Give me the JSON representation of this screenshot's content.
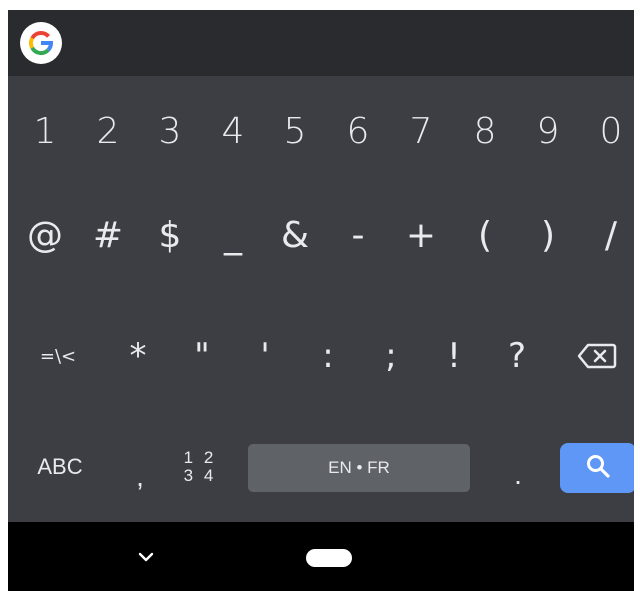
{
  "top_bar": {
    "logo_icon": "google-logo-icon",
    "logo_letter": "G"
  },
  "keyboard": {
    "number_row": [
      "1",
      "2",
      "3",
      "4",
      "5",
      "6",
      "7",
      "8",
      "9",
      "0"
    ],
    "symbol_row": [
      "@",
      "#",
      "$",
      "_",
      "&",
      "-",
      "+",
      "(",
      ")",
      "/"
    ],
    "third_row": {
      "more_symbols": "=\\<",
      "keys": [
        "*",
        "\"",
        "'",
        ":",
        ";",
        "!",
        "?"
      ],
      "backspace_icon": "backspace-icon"
    },
    "bottom_row": {
      "abc_label": "ABC",
      "comma_label": ",",
      "numpad_top": "1 2",
      "numpad_bottom": "3 4",
      "space_label": "EN • FR",
      "period_label": ".",
      "search_icon": "search-icon"
    },
    "colors": {
      "background": "#3c3e43",
      "key_text": "#e8eaed",
      "space_bar": "#5f6368",
      "action_key": "#5e97f6"
    }
  },
  "nav_bar": {
    "back_icon": "chevron-down-icon",
    "home_icon": "home-pill-icon"
  }
}
